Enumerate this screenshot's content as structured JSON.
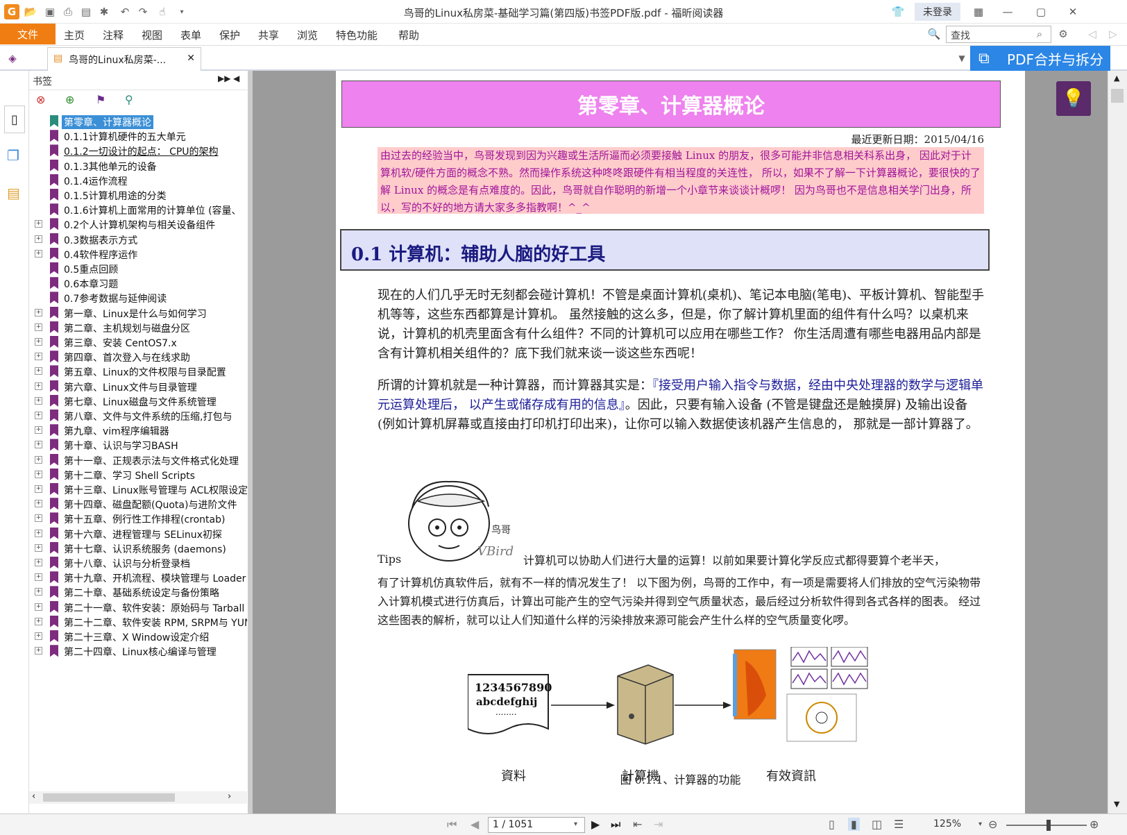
{
  "window": {
    "title": "鸟哥的Linux私房菜-基础学习篇(第四版)书签PDF版.pdf - 福昕阅读器",
    "login_label": "未登录"
  },
  "menu": {
    "file": "文件",
    "items": [
      "主页",
      "注释",
      "视图",
      "表单",
      "保护",
      "共享",
      "浏览",
      "特色功能",
      "帮助"
    ],
    "search_placeholder": "查找"
  },
  "tab": {
    "label": "鸟哥的Linux私房菜-...",
    "pdf_merge": "PDF合并与拆分"
  },
  "bookmarks": {
    "title": "书签",
    "items": [
      {
        "label": "第零章、计算器概论",
        "expandable": false,
        "level": 0,
        "selected": true
      },
      {
        "label": "0.1.1计算机硬件的五大单元",
        "expandable": false,
        "level": 1
      },
      {
        "label": "0.1.2一切设计的起点： CPU的架构",
        "expandable": false,
        "level": 1,
        "underline": true
      },
      {
        "label": "0.1.3其他单元的设备",
        "expandable": false,
        "level": 1
      },
      {
        "label": "0.1.4运作流程",
        "expandable": false,
        "level": 1
      },
      {
        "label": "0.1.5计算机用途的分类",
        "expandable": false,
        "level": 1
      },
      {
        "label": "0.1.6计算机上面常用的计算单位 (容量、",
        "expandable": false,
        "level": 1
      },
      {
        "label": "0.2个人计算机架构与相关设备组件",
        "expandable": true,
        "level": 1
      },
      {
        "label": "0.3数据表示方式",
        "expandable": true,
        "level": 1
      },
      {
        "label": "0.4软件程序运作",
        "expandable": true,
        "level": 1
      },
      {
        "label": "0.5重点回顾",
        "expandable": false,
        "level": 1
      },
      {
        "label": "0.6本章习题",
        "expandable": false,
        "level": 1
      },
      {
        "label": "0.7参考数据与延伸阅读",
        "expandable": false,
        "level": 1
      },
      {
        "label": "第一章、Linux是什么与如何学习",
        "expandable": true,
        "level": 1
      },
      {
        "label": "第二章、主机规划与磁盘分区",
        "expandable": true,
        "level": 1
      },
      {
        "label": "第三章、安装 CentOS7.x",
        "expandable": true,
        "level": 1
      },
      {
        "label": "第四章、首次登入与在线求助",
        "expandable": true,
        "level": 1
      },
      {
        "label": "第五章、Linux的文件权限与目录配置",
        "expandable": true,
        "level": 1
      },
      {
        "label": "第六章、Linux文件与目录管理",
        "expandable": true,
        "level": 1
      },
      {
        "label": "第七章、Linux磁盘与文件系统管理",
        "expandable": true,
        "level": 1
      },
      {
        "label": "第八章、文件与文件系统的压缩,打包与",
        "expandable": true,
        "level": 1
      },
      {
        "label": "第九章、vim程序编辑器",
        "expandable": true,
        "level": 1
      },
      {
        "label": "第十章、认识与学习BASH",
        "expandable": true,
        "level": 1
      },
      {
        "label": "第十一章、正规表示法与文件格式化处理",
        "expandable": true,
        "level": 1
      },
      {
        "label": "第十二章、学习 Shell Scripts",
        "expandable": true,
        "level": 1
      },
      {
        "label": "第十三章、Linux账号管理与 ACL权限设定",
        "expandable": true,
        "level": 1
      },
      {
        "label": "第十四章、磁盘配额(Quota)与进阶文件",
        "expandable": true,
        "level": 1
      },
      {
        "label": "第十五章、例行性工作排程(crontab)",
        "expandable": true,
        "level": 1
      },
      {
        "label": "第十六章、进程管理与 SELinux初探",
        "expandable": true,
        "level": 1
      },
      {
        "label": "第十七章、认识系统服务 (daemons)",
        "expandable": true,
        "level": 1
      },
      {
        "label": "第十八章、认识与分析登录档",
        "expandable": true,
        "level": 1
      },
      {
        "label": "第十九章、开机流程、模块管理与 Loader",
        "expandable": true,
        "level": 1
      },
      {
        "label": "第二十章、基础系统设定与备份策略",
        "expandable": true,
        "level": 1
      },
      {
        "label": "第二十一章、软件安装：原始码与 Tarball",
        "expandable": true,
        "level": 1
      },
      {
        "label": "第二十二章、软件安装 RPM, SRPM与 YUM",
        "expandable": true,
        "level": 1
      },
      {
        "label": "第二十三章、X Window设定介绍",
        "expandable": true,
        "level": 1
      },
      {
        "label": "第二十四章、Linux核心编译与管理",
        "expandable": true,
        "level": 1
      }
    ]
  },
  "page": {
    "chapter_title": "第零章、计算器概论",
    "update_date": "最近更新日期：2015/04/16",
    "note": "由过去的经验当中，鸟哥发现到因为兴趣或生活所逼而必须要接触 Linux 的朋友，很多可能并非信息相关科系出身， 因此对于计算机软/硬件方面的概念不熟。然而操作系统这种咚咚跟硬件有相当程度的关连性， 所以，如果不了解一下计算器概论，要很快的了解 Linux 的概念是有点难度的。因此，鸟哥就自作聪明的新增一个小章节来谈谈计概啰！ 因为鸟哥也不是信息相关学门出身，所以，写的不好的地方请大家多多指教啊！^_^",
    "section_title": "0.1 计算机：辅助人脑的好工具",
    "para1": "现在的人们几乎无时无刻都会碰计算机！不管是桌面计算机(桌机)、笔记本电脑(笔电)、平板计算机、智能型手机等等，这些东西都算是计算机。 虽然接触的这么多，但是，你了解计算机里面的组件有什么吗？以桌机来说，计算机的机壳里面含有什么组件？不同的计算机可以应用在哪些工作？ 你生活周遭有哪些电器用品内部是含有计算机相关组件的？底下我们就来谈一谈这些东西呢！",
    "para2_pre": "所谓的计算机就是一种计算器，而计算器其实是：",
    "para2_quote": "『接受用户输入指令与数据，经由中央处理器的数学与逻辑单元运算处理后， 以产生或储存成有用的信息』",
    "para2_post": "。因此，只要有输入设备 (不管是键盘还是触摸屏) 及输出设备 (例如计算机屏幕或直接由打印机打印出来)，让你可以输入数据使该机器产生信息的， 那就是一部计算器了。",
    "tips_label": "Tips",
    "tips_first_line": "计算机可以协助人们进行大量的运算！以前如果要计算化学反应式都得要算个老半天，",
    "tips_rest": "有了计算机仿真软件后，就有不一样的情况发生了！ 以下图为例，鸟哥的工作中，有一项是需要将人们排放的空气污染物带入计算机模式进行仿真后，计算出可能产生的空气污染并得到空气质量状态，最后经过分析软件得到各式各样的图表。 经过这些图表的解析，就可以让人们知道什么样的污染排放来源可能会产生什么样的空气质量变化啰。",
    "cartoon_sig": "鸟哥",
    "cartoon_vbird": "VBird",
    "figure": {
      "data_text1": "1234567890",
      "data_text2": "abcdefghij",
      "data_dots": "........",
      "label_data": "資料",
      "label_computer": "計算機",
      "label_info": "有效資訊"
    },
    "figure_caption": "图 0.1.1、计算器的功能"
  },
  "status": {
    "page_input": "1 / 1051",
    "zoom": "125%"
  }
}
